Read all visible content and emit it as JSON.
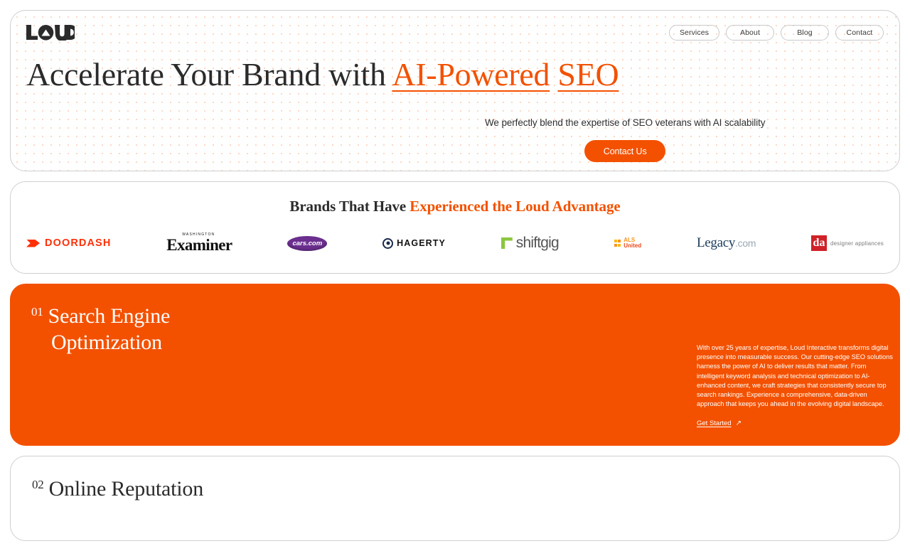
{
  "brand": {
    "logo_text": "LOUD",
    "accent_color": "#f35100"
  },
  "nav": {
    "items": [
      {
        "label": "Services"
      },
      {
        "label": "About"
      },
      {
        "label": "Blog"
      },
      {
        "label": "Contact"
      }
    ]
  },
  "hero": {
    "title_plain": "Accelerate Your Brand with ",
    "title_highlight_1": "AI-Powered",
    "title_space": " ",
    "title_highlight_2": "SEO",
    "subtitle": "We perfectly blend the expertise of SEO veterans with AI scalability",
    "cta_label": "Contact Us"
  },
  "brands_section": {
    "heading_plain": "Brands That Have ",
    "heading_highlight": "Experienced the Loud Advantage",
    "logos": [
      {
        "name": "DoorDash",
        "label": "DOORDASH"
      },
      {
        "name": "Washington Examiner",
        "eyebrow": "WASHINGTON",
        "label": "Examiner"
      },
      {
        "name": "cars.com",
        "label": "cars.com"
      },
      {
        "name": "Hagerty",
        "label": "HAGERTY"
      },
      {
        "name": "shiftgig",
        "label": "shiftgig"
      },
      {
        "name": "ALS United",
        "label_top": "ALS",
        "label_bottom": "United"
      },
      {
        "name": "Legacy.com",
        "label": "Legacy",
        "suffix": ".com"
      },
      {
        "name": "designer appliances",
        "mark": "da",
        "label": "designer appliances"
      }
    ]
  },
  "services": [
    {
      "number": "01",
      "title_line_1": "Search Engine",
      "title_line_2": "Optimization",
      "body": "With over 25 years of expertise, Loud Interactive transforms digital presence into measurable success. Our cutting-edge SEO solutions harness the power of AI to deliver results that matter. From intelligent keyword analysis and technical optimization to AI-enhanced content, we craft strategies that consistently secure top search rankings. Experience a comprehensive, data-driven approach that keeps you ahead in the evolving digital landscape.",
      "link_label": "Get Started",
      "link_arrow": "↗"
    },
    {
      "number": "02",
      "title_line_1": "Online Reputation",
      "title_line_2": ""
    }
  ]
}
